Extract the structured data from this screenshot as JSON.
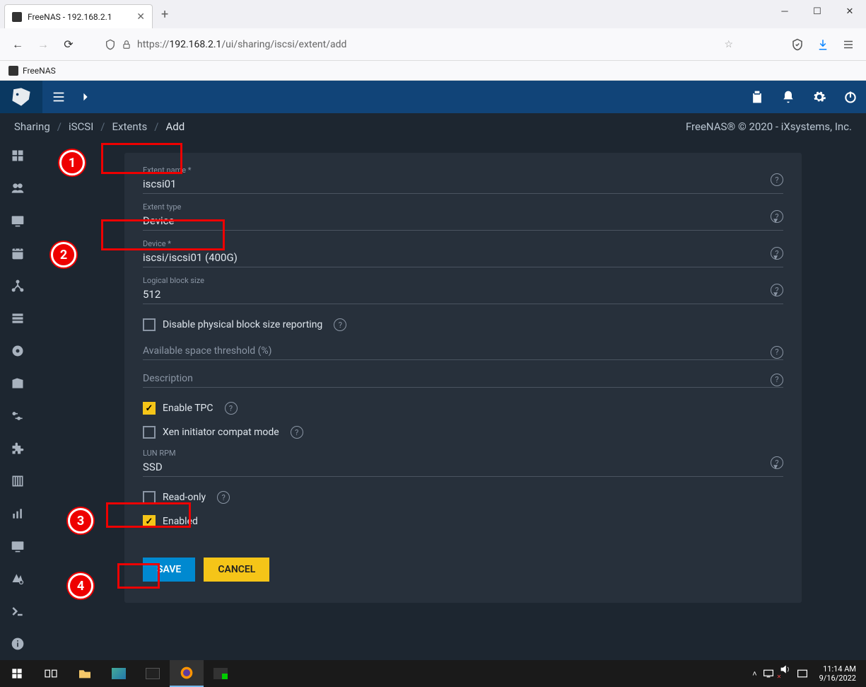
{
  "browser": {
    "tab_title": "FreeNAS - 192.168.2.1",
    "url_prefix": "https://",
    "url_host": "192.168.2.1",
    "url_path": "/ui/sharing/iscsi/extent/add"
  },
  "bookmark": {
    "label": "FreeNAS"
  },
  "breadcrumb": {
    "items": [
      "Sharing",
      "iSCSI",
      "Extents",
      "Add"
    ],
    "copyright": "FreeNAS® © 2020 - iXsystems, Inc."
  },
  "form": {
    "extent_name": {
      "label": "Extent name *",
      "value": "iscsi01"
    },
    "extent_type": {
      "label": "Extent type",
      "value": "Device"
    },
    "device": {
      "label": "Device *",
      "value": "iscsi/iscsi01 (400G)"
    },
    "logical_block_size": {
      "label": "Logical block size",
      "value": "512"
    },
    "disable_phys": {
      "label": "Disable physical block size reporting"
    },
    "threshold": {
      "label": "Available space threshold (%)"
    },
    "description": {
      "label": "Description"
    },
    "enable_tpc": {
      "label": "Enable TPC"
    },
    "xen": {
      "label": "Xen initiator compat mode"
    },
    "lun_rpm": {
      "label": "LUN RPM",
      "value": "SSD"
    },
    "readonly": {
      "label": "Read-only"
    },
    "enabled": {
      "label": "Enabled"
    }
  },
  "buttons": {
    "save": "SAVE",
    "cancel": "CANCEL"
  },
  "markers": {
    "m1": "1",
    "m2": "2",
    "m3": "3",
    "m4": "4"
  },
  "taskbar": {
    "time": "11:14 AM",
    "date": "9/16/2022"
  }
}
